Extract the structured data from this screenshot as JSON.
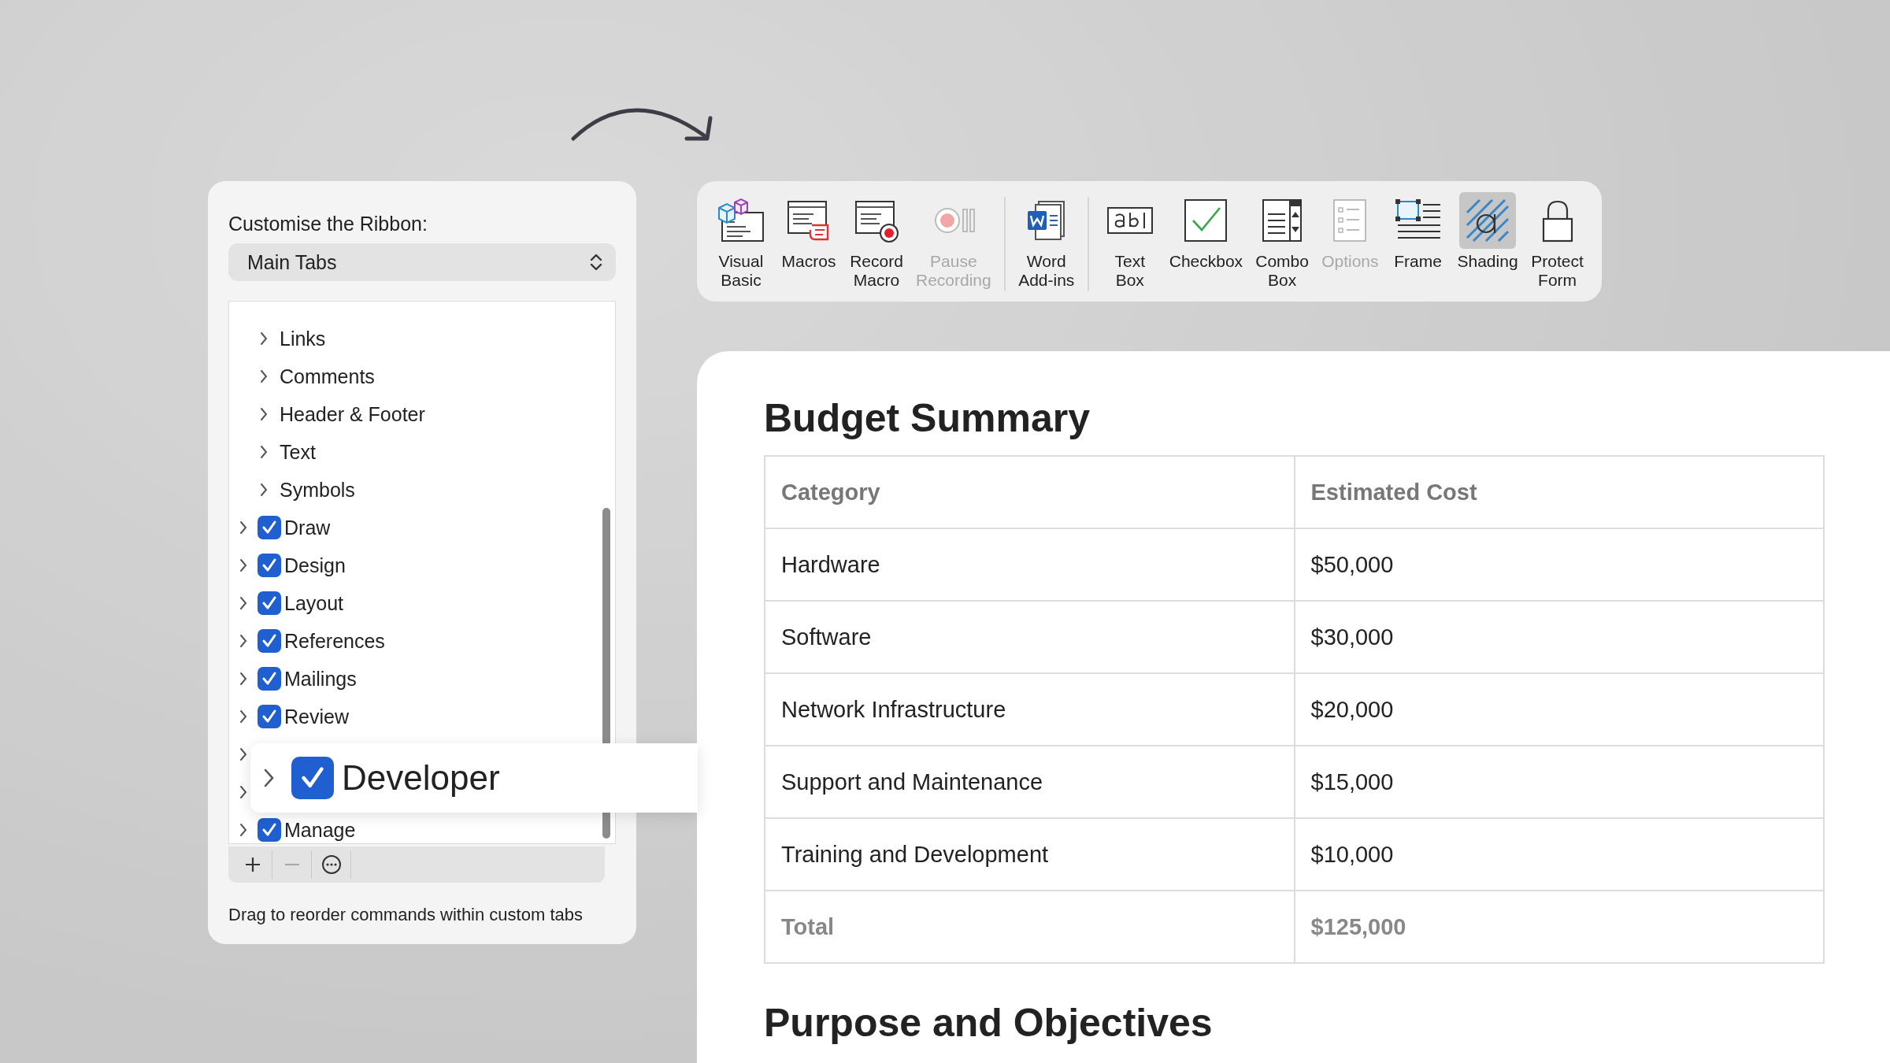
{
  "ribbon_panel": {
    "title": "Customise the Ribbon:",
    "dropdown": {
      "value": "Main Tabs"
    },
    "tree": [
      {
        "kind": "group",
        "label": "Links"
      },
      {
        "kind": "group",
        "label": "Comments"
      },
      {
        "kind": "group",
        "label": "Header & Footer"
      },
      {
        "kind": "group",
        "label": "Text"
      },
      {
        "kind": "group",
        "label": "Symbols"
      },
      {
        "kind": "tab",
        "label": "Draw",
        "checked": true
      },
      {
        "kind": "tab",
        "label": "Design",
        "checked": true
      },
      {
        "kind": "tab",
        "label": "Layout",
        "checked": true
      },
      {
        "kind": "tab",
        "label": "References",
        "checked": true
      },
      {
        "kind": "tab",
        "label": "Mailings",
        "checked": true
      },
      {
        "kind": "tab",
        "label": "Review",
        "checked": true
      },
      {
        "kind": "covered"
      },
      {
        "kind": "covered"
      },
      {
        "kind": "tab",
        "label": "Manage",
        "checked": true
      }
    ],
    "actions": [
      {
        "kind": "add",
        "disabled": false
      },
      {
        "kind": "remove",
        "disabled": true
      },
      {
        "kind": "more",
        "disabled": false
      }
    ],
    "hint": "Drag to reorder commands within custom tabs"
  },
  "drag_preview": {
    "label": "Developer",
    "checked": true
  },
  "toolbar": {
    "groups": [
      {
        "items": [
          {
            "kind": "vba",
            "label": "Visual\nBasic",
            "disabled": false,
            "selected": false
          },
          {
            "kind": "macros",
            "label": "Macros",
            "disabled": false,
            "selected": false
          },
          {
            "kind": "record",
            "label": "Record\nMacro",
            "disabled": false,
            "selected": false
          },
          {
            "kind": "pause",
            "label": "Pause\nRecording",
            "disabled": true,
            "selected": false
          }
        ]
      },
      {
        "items": [
          {
            "kind": "addins",
            "label": "Word\nAdd-ins",
            "disabled": false,
            "selected": false
          }
        ]
      },
      {
        "items": [
          {
            "kind": "textbox",
            "label": "Text\nBox",
            "disabled": false,
            "selected": false
          },
          {
            "kind": "checkbox",
            "label": "Checkbox",
            "disabled": false,
            "selected": false
          },
          {
            "kind": "combo",
            "label": "Combo\nBox",
            "disabled": false,
            "selected": false
          },
          {
            "kind": "options",
            "label": "Options",
            "disabled": true,
            "selected": false
          },
          {
            "kind": "frame",
            "label": "Frame",
            "disabled": false,
            "selected": false
          },
          {
            "kind": "shading",
            "label": "Shading",
            "disabled": false,
            "selected": true
          },
          {
            "kind": "lock",
            "label": "Protect\nForm",
            "disabled": false,
            "selected": false
          }
        ]
      }
    ]
  },
  "document": {
    "heading": "Budget Summary",
    "table": {
      "columns": [
        "Category",
        "Estimated Cost"
      ],
      "rows": [
        [
          "Hardware",
          "$50,000"
        ],
        [
          "Software",
          "$30,000"
        ],
        [
          "Network Infrastructure",
          "$20,000"
        ],
        [
          "Support and Maintenance",
          "$15,000"
        ],
        [
          "Training and Development",
          "$10,000"
        ]
      ],
      "total": [
        "Total",
        "$125,000"
      ]
    },
    "next_heading": "Purpose and Objectives"
  }
}
